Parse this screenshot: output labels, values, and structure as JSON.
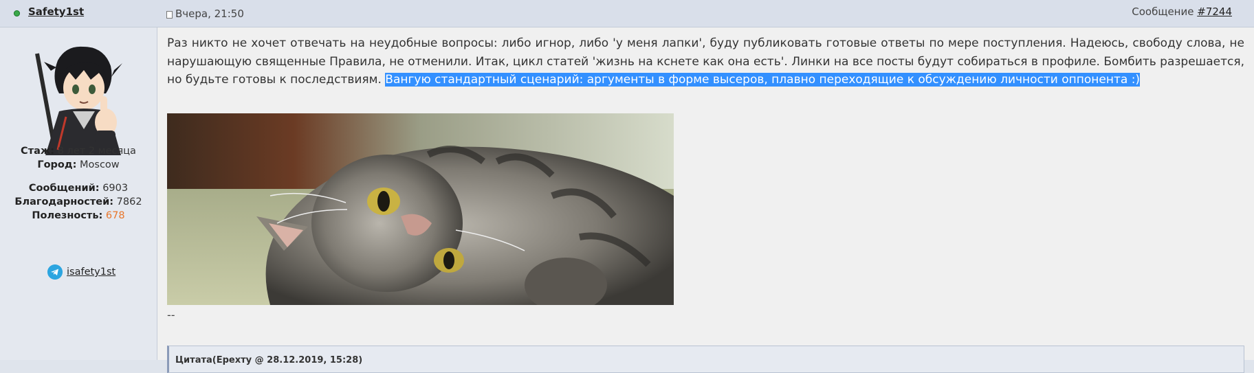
{
  "post": {
    "author": "Safety1st",
    "date": "Вчера, 21:50",
    "message_label": "Сообщение ",
    "message_number": "#7244",
    "text_main": "Раз никто не хочет отвечать на неудобные вопросы: либо игнор, либо 'у меня лапки', буду публиковать готовые ответы по мере поступления. Надеюсь, свободу слова, не нарушающую священные Правила, не отменили. Итак, цикл статей 'жизнь на кснете как она есть'. Линки на все посты будут собираться в профиле. Бомбить разрешается, но будьте готовы к последствиям. ",
    "text_selected": "Вангую стандартный сценарий: аргументы в форме высеров, плавно переходящие к обсуждению личности оппонента :)",
    "signature": "--",
    "quote_title": "Цитата(Ерехту @ 28.12.2019, 15:28)"
  },
  "profile": {
    "tenure_label": "Стаж:",
    "tenure_value": " 8 лет 2 месяца",
    "city_label": "Город:",
    "city_value": " Moscow",
    "messages_label": "Сообщений:",
    "messages_value": " 6903",
    "thanks_label": "Благодарностей:",
    "thanks_value": " 7862",
    "usefulness_label": "Полезность:",
    "usefulness_value": " 678",
    "telegram": "isafety1st"
  },
  "colors": {
    "online": "#3aa84a",
    "selection": "#3390ff",
    "usefulness": "#e8762b",
    "telegram": "#2ca5e0"
  }
}
